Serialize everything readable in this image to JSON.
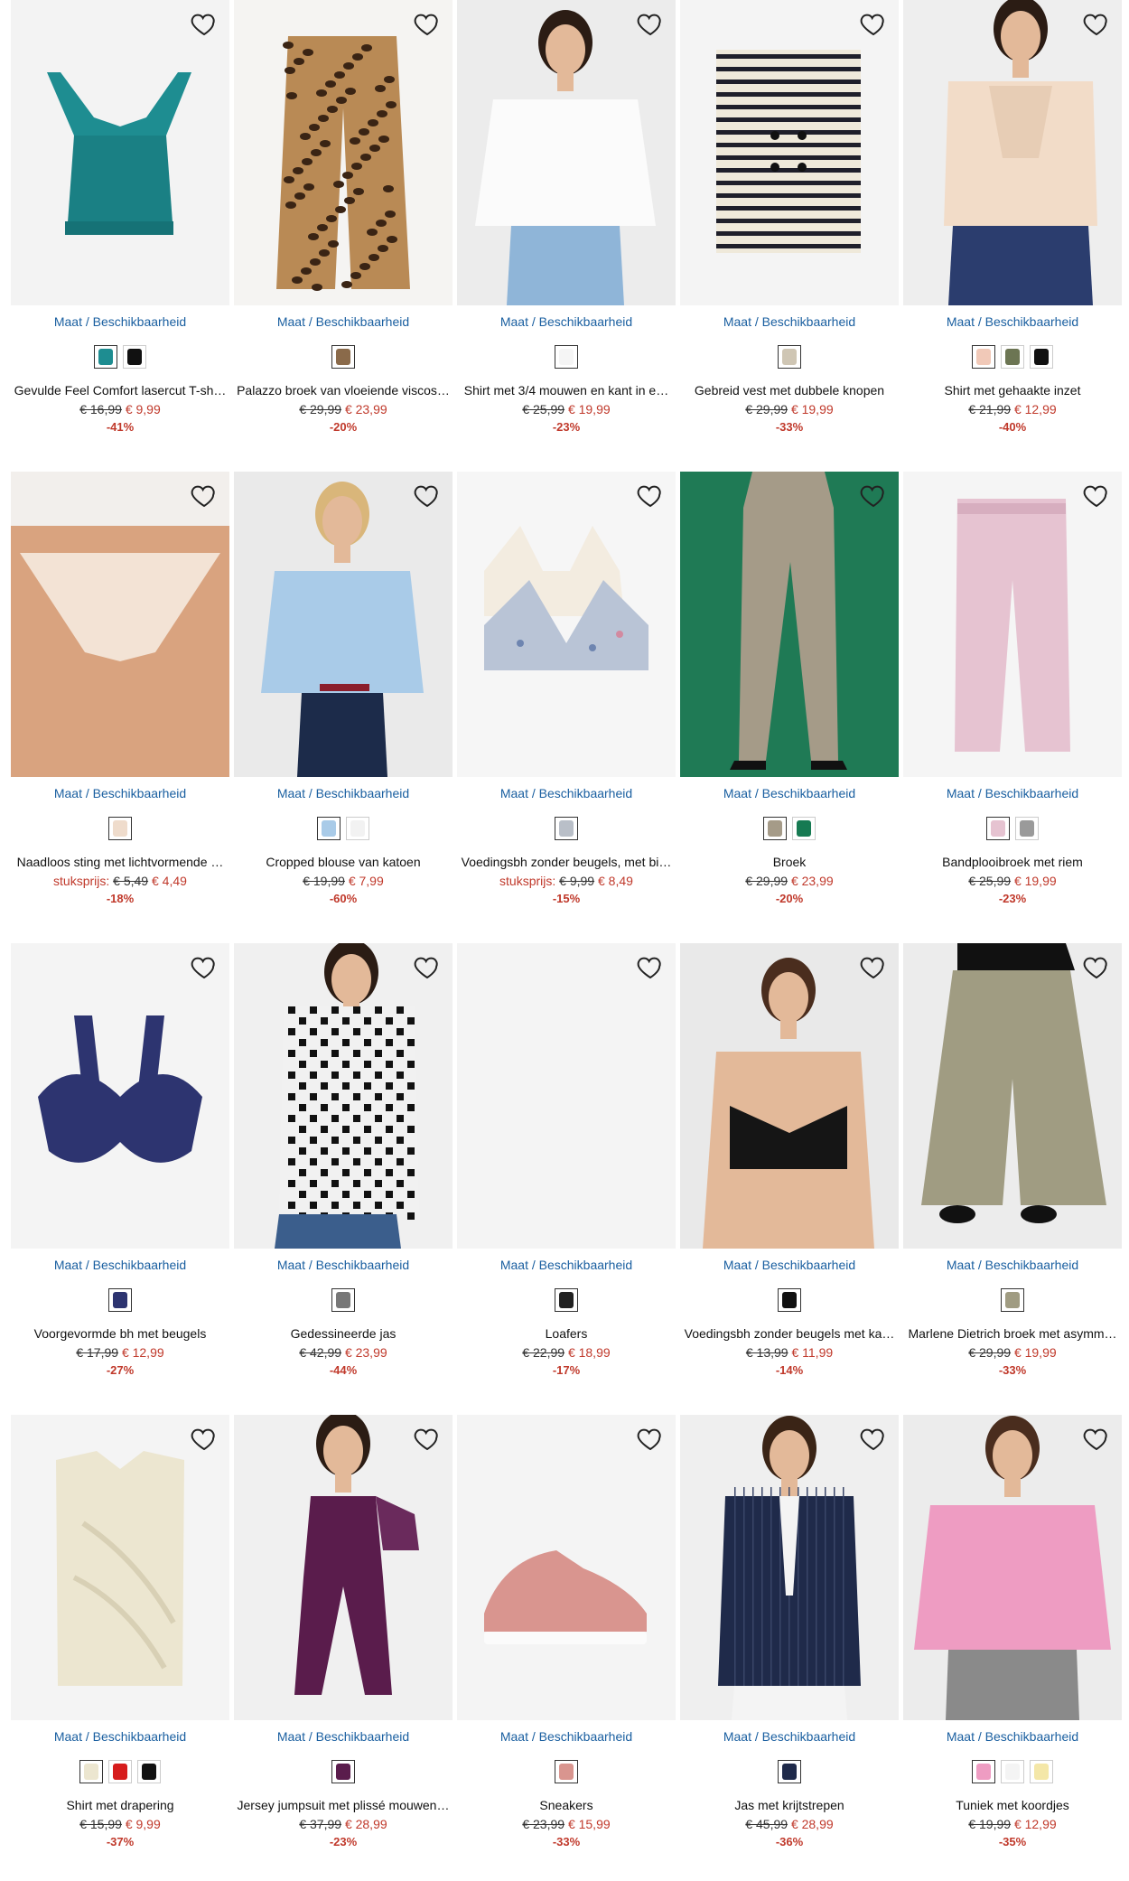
{
  "common": {
    "maat_label": "Maat / Beschikbaarheid",
    "stuksprijs_label": "stuksprijs:"
  },
  "products": [
    {
      "title": "Gevulde Feel Comfort lasercut T-sh…",
      "old_price": "€ 16,99",
      "new_price": "€ 9,99",
      "discount": "-41%",
      "swatches": [
        "#1e8d91",
        "#111111"
      ],
      "image": "bra-teal",
      "bg": "#f3f3f3"
    },
    {
      "title": "Palazzo broek van vloeiende viscos…",
      "old_price": "€ 29,99",
      "new_price": "€ 23,99",
      "discount": "-20%",
      "swatches": [
        "#8a6a4a"
      ],
      "image": "leopard-pants",
      "bg": "#f5f4f2"
    },
    {
      "title": "Shirt met 3/4 mouwen en kant in e…",
      "old_price": "€ 25,99",
      "new_price": "€ 19,99",
      "discount": "-23%",
      "swatches": [
        "#f5f5f5"
      ],
      "image": "white-blouse",
      "bg": "#ececec"
    },
    {
      "title": "Gebreid vest met dubbele knopen",
      "old_price": "€ 29,99",
      "new_price": "€ 19,99",
      "discount": "-33%",
      "swatches": [
        "#cfc6b4"
      ],
      "image": "striped-cardigan",
      "bg": "#f4f4f4"
    },
    {
      "title": "Shirt met gehaakte inzet",
      "old_price": "€ 21,99",
      "new_price": "€ 12,99",
      "discount": "-40%",
      "swatches": [
        "#f1c9b8",
        "#6c7553",
        "#111111"
      ],
      "image": "crochet-top",
      "bg": "#eeeeee"
    },
    {
      "title": "Naadloos sting met lichtvormende …",
      "unit_price": true,
      "old_price": "€ 5,49",
      "new_price": "€ 4,49",
      "discount": "-18%",
      "swatches": [
        "#efdccc"
      ],
      "image": "thong",
      "bg": "#f2efec"
    },
    {
      "title": "Cropped blouse van katoen",
      "old_price": "€ 19,99",
      "new_price": "€ 7,99",
      "discount": "-60%",
      "swatches": [
        "#a9cbe8",
        "#f2f2f2"
      ],
      "image": "blue-blouse",
      "bg": "#eaeaea"
    },
    {
      "title": "Voedingsbh zonder beugels, met bi…",
      "unit_price": true,
      "old_price": "€ 9,99",
      "new_price": "€ 8,49",
      "discount": "-15%",
      "swatches": [
        "#b9bfc8"
      ],
      "image": "nursing-bras",
      "bg": "#f6f6f6"
    },
    {
      "title": "Broek",
      "old_price": "€ 29,99",
      "new_price": "€ 23,99",
      "discount": "-20%",
      "swatches": [
        "#a59b88",
        "#167a52"
      ],
      "image": "khaki-trousers",
      "bg": "#1f7a55"
    },
    {
      "title": "Bandplooibroek met riem",
      "old_price": "€ 25,99",
      "new_price": "€ 19,99",
      "discount": "-23%",
      "swatches": [
        "#e6c3d1",
        "#9a9a9a"
      ],
      "image": "pink-trousers",
      "bg": "#f5f5f5"
    },
    {
      "title": "Voorgevormde bh met beugels",
      "old_price": "€ 17,99",
      "new_price": "€ 12,99",
      "discount": "-27%",
      "swatches": [
        "#2d3470"
      ],
      "image": "navy-bra",
      "bg": "#f4f4f4"
    },
    {
      "title": "Gedessineerde jas",
      "old_price": "€ 42,99",
      "new_price": "€ 23,99",
      "discount": "-44%",
      "swatches": [
        "#777777"
      ],
      "image": "houndstooth-jacket",
      "bg": "#f0f0f0"
    },
    {
      "title": "Loafers",
      "old_price": "€ 22,99",
      "new_price": "€ 18,99",
      "discount": "-17%",
      "swatches": [
        "#222222"
      ],
      "image": "loafers",
      "bg": "#f4f4f4"
    },
    {
      "title": "Voedingsbh zonder beugels met ka…",
      "old_price": "€ 13,99",
      "new_price": "€ 11,99",
      "discount": "-14%",
      "swatches": [
        "#111111"
      ],
      "image": "black-lace-bra",
      "bg": "#e9e9e9"
    },
    {
      "title": "Marlene Dietrich broek met asymm…",
      "old_price": "€ 29,99",
      "new_price": "€ 19,99",
      "discount": "-33%",
      "swatches": [
        "#a09c82"
      ],
      "image": "olive-wide-pants",
      "bg": "#ececec"
    },
    {
      "title": "Shirt met drapering",
      "old_price": "€ 15,99",
      "new_price": "€ 9,99",
      "discount": "-37%",
      "swatches": [
        "#ece6d0",
        "#d61c1c",
        "#111111"
      ],
      "image": "draped-top",
      "bg": "#f4f4f4"
    },
    {
      "title": "Jersey jumpsuit met plissé mouwen…",
      "old_price": "€ 37,99",
      "new_price": "€ 28,99",
      "discount": "-23%",
      "swatches": [
        "#5a1c4c"
      ],
      "image": "plum-jumpsuit",
      "bg": "#f0f0f0"
    },
    {
      "title": "Sneakers",
      "old_price": "€ 23,99",
      "new_price": "€ 15,99",
      "discount": "-33%",
      "swatches": [
        "#d9958f"
      ],
      "image": "pink-sneakers",
      "bg": "#f4f4f4"
    },
    {
      "title": "Jas met krijtstrepen",
      "old_price": "€ 45,99",
      "new_price": "€ 28,99",
      "discount": "-36%",
      "swatches": [
        "#1f2a4a"
      ],
      "image": "pinstripe-blazer",
      "bg": "#efefef"
    },
    {
      "title": "Tuniek met koordjes",
      "old_price": "€ 19,99",
      "new_price": "€ 12,99",
      "discount": "-35%",
      "swatches": [
        "#ee9cc2",
        "#f4f4f4",
        "#f4e7a8"
      ],
      "image": "pink-tunic",
      "bg": "#ececec"
    }
  ]
}
